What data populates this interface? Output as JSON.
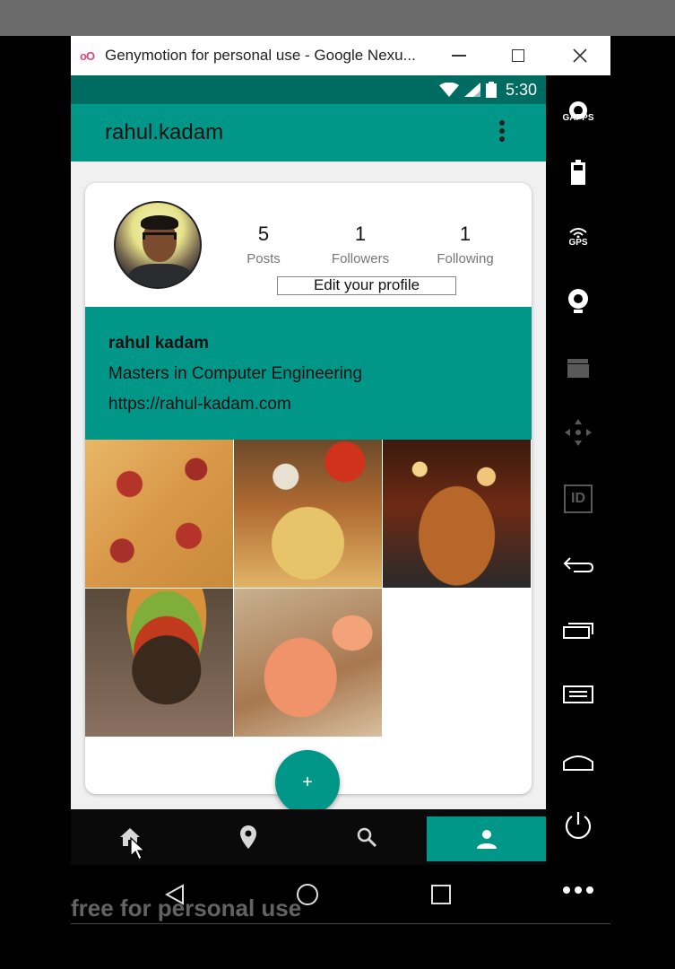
{
  "window": {
    "title": "Genymotion for personal use - Google Nexu..."
  },
  "status_bar": {
    "time": "5:30"
  },
  "app_bar": {
    "title": "rahul.kadam"
  },
  "profile": {
    "stats": [
      {
        "value": "5",
        "label": "Posts"
      },
      {
        "value": "1",
        "label": "Followers"
      },
      {
        "value": "1",
        "label": "Following"
      }
    ],
    "edit_label": "Edit your profile",
    "name": "rahul kadam",
    "description": "Masters in Computer Engineering",
    "website": "https://rahul-kadam.com"
  },
  "fab": {
    "label": "+"
  },
  "bottom_nav": {
    "items": [
      "home",
      "map",
      "search",
      "profile"
    ],
    "active": "profile"
  },
  "toolbar": {
    "gapps_label": "GAPPS",
    "gps_label": "GPS",
    "id_label": "ID"
  },
  "watermark": "free for personal use",
  "colors": {
    "accent": "#009688",
    "status_bar": "#006b61"
  }
}
